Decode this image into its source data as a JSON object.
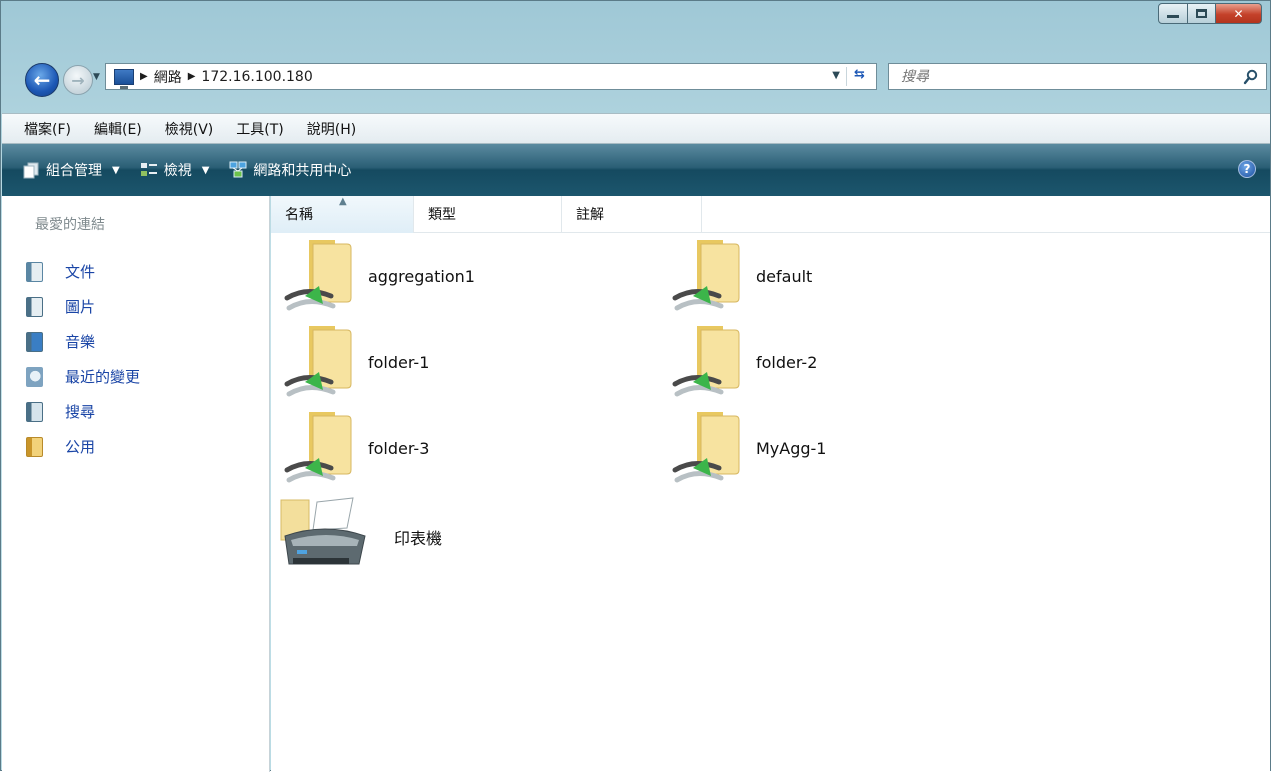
{
  "address": {
    "crumbs": [
      "網路",
      "172.16.100.180"
    ]
  },
  "search": {
    "placeholder": "搜尋"
  },
  "menu": {
    "items": [
      "檔案(F)",
      "編輯(E)",
      "檢視(V)",
      "工具(T)",
      "說明(H)"
    ]
  },
  "toolbar": {
    "organize": "組合管理",
    "views": "檢視",
    "network_center": "網路和共用中心"
  },
  "navpane": {
    "heading": "最愛的連結",
    "items": [
      {
        "label": "文件",
        "icon": "documents-icon",
        "color": "#5a86a3"
      },
      {
        "label": "圖片",
        "icon": "pictures-icon",
        "color": "#4a8f5c"
      },
      {
        "label": "音樂",
        "icon": "music-icon",
        "color": "#3a7ec4"
      },
      {
        "label": "最近的變更",
        "icon": "recent-changes-icon",
        "color": "#7ea3c0"
      },
      {
        "label": "搜尋",
        "icon": "search-folder-icon",
        "color": "#5c7fa0"
      },
      {
        "label": "公用",
        "icon": "public-folder-icon",
        "color": "#e2b84a"
      }
    ]
  },
  "columns": {
    "name": "名稱",
    "type": "類型",
    "note": "註解"
  },
  "items": [
    {
      "label": "aggregation1",
      "icon": "network-share-folder-icon"
    },
    {
      "label": "default",
      "icon": "network-share-folder-icon"
    },
    {
      "label": "folder-1",
      "icon": "network-share-folder-icon"
    },
    {
      "label": "folder-2",
      "icon": "network-share-folder-icon"
    },
    {
      "label": "folder-3",
      "icon": "network-share-folder-icon"
    },
    {
      "label": "MyAgg-1",
      "icon": "network-share-folder-icon"
    },
    {
      "label": "印表機",
      "icon": "printer-icon"
    }
  ],
  "colors": {
    "toolbar": "#1c566d",
    "link": "#1a45a6",
    "close": "#c4412a"
  }
}
